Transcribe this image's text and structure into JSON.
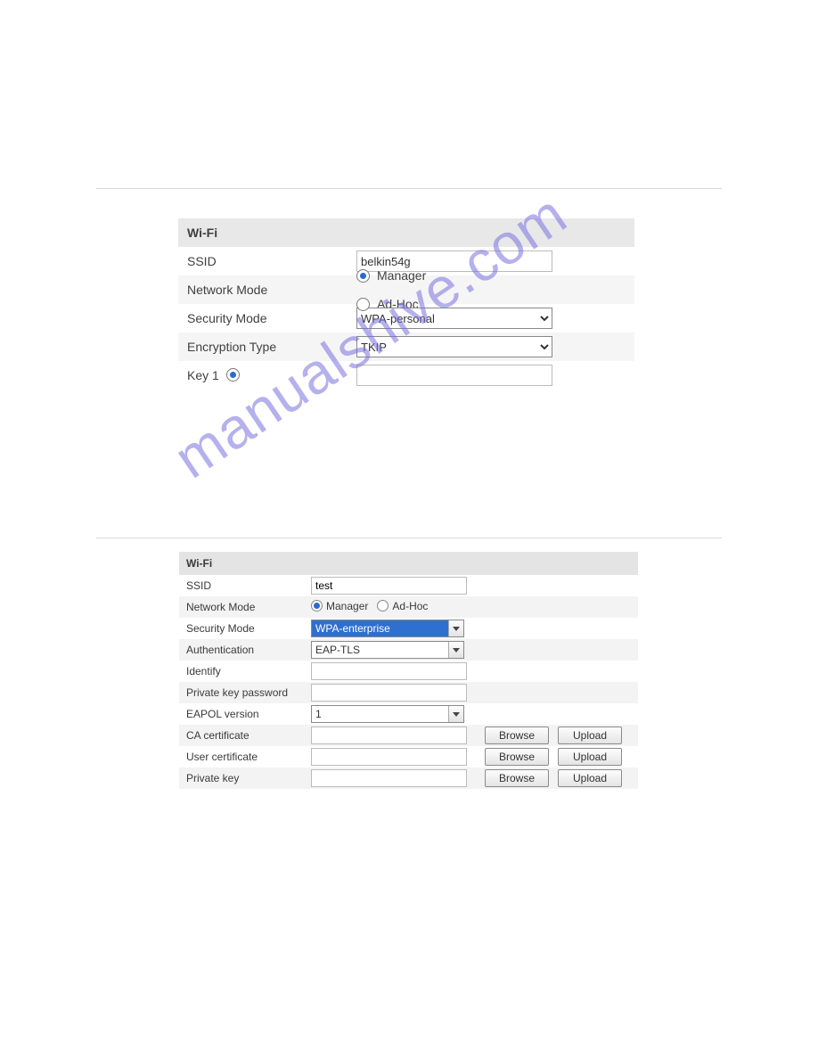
{
  "watermark": "manualshive.com",
  "panel1": {
    "title": "Wi-Fi",
    "ssid_label": "SSID",
    "ssid_value": "belkin54g",
    "network_mode_label": "Network Mode",
    "nm_opt1": "Manager",
    "nm_opt2": "Ad-Hoc",
    "security_mode_label": "Security Mode",
    "security_mode_value": "WPA-personal",
    "encryption_type_label": "Encryption Type",
    "encryption_type_value": "TKIP",
    "key1_label": "Key 1",
    "key1_value": ""
  },
  "panel2": {
    "title": "Wi-Fi",
    "ssid_label": "SSID",
    "ssid_value": "test",
    "network_mode_label": "Network Mode",
    "nm_opt1": "Manager",
    "nm_opt2": "Ad-Hoc",
    "security_mode_label": "Security Mode",
    "security_mode_value": "WPA-enterprise",
    "auth_label": "Authentication",
    "auth_value": "EAP-TLS",
    "identify_label": "Identify",
    "identify_value": "",
    "pkpwd_label": "Private key password",
    "pkpwd_value": "",
    "eapol_label": "EAPOL version",
    "eapol_value": "1",
    "ca_label": "CA certificate",
    "ca_value": "",
    "user_cert_label": "User certificate",
    "user_cert_value": "",
    "private_key_label": "Private key",
    "private_key_value": "",
    "browse_label": "Browse",
    "upload_label": "Upload"
  }
}
